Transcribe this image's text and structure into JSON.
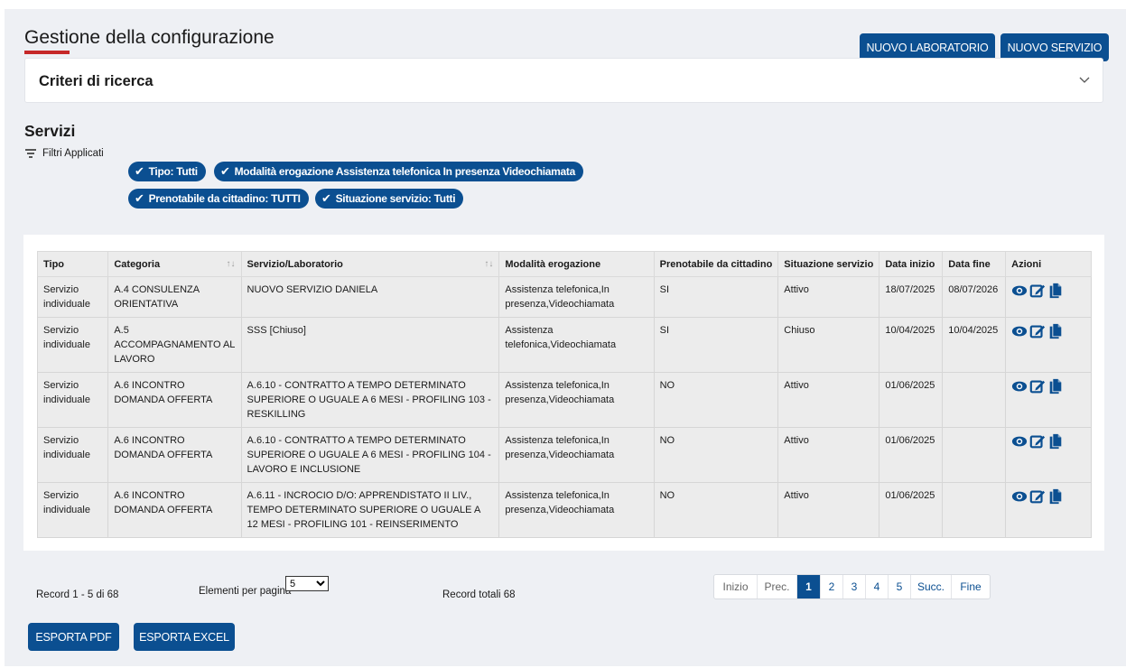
{
  "header": {
    "title": "Gestione della configurazione",
    "btn_new_lab": "NUOVO LABORATORIO",
    "btn_new_service": "NUOVO SERVIZIO"
  },
  "criteri": {
    "label": "Criteri di ricerca"
  },
  "servizi": {
    "title": "Servizi",
    "filters_label": "Filtri Applicati",
    "chips": [
      "Tipo: Tutti",
      "Modalità erogazione  Assistenza telefonica  In presenza  Videochiamata",
      "Prenotabile da cittadino: TUTTI",
      "Situazione servizio: Tutti"
    ]
  },
  "table": {
    "headers": [
      "Tipo",
      "Categoria",
      "Servizio/Laboratorio",
      "Modalità erogazione",
      "Prenotabile da cittadino",
      "Situazione servizio",
      "Data inizio",
      "Data fine",
      "Azioni"
    ],
    "rows": [
      {
        "tipo": "Servizio individuale",
        "categoria": "A.4 CONSULENZA ORIENTATIVA",
        "servizio": "NUOVO SERVIZIO DANIELA",
        "modalita": "Assistenza telefonica,In presenza,Videochiamata",
        "prenotabile": "SI",
        "situazione": "Attivo",
        "inizio": "18/07/2025",
        "fine": "08/07/2026"
      },
      {
        "tipo": "Servizio individuale",
        "categoria": "A.5 ACCOMPAGNAMENTO AL LAVORO",
        "servizio": "SSS [Chiuso]",
        "modalita": "Assistenza telefonica,Videochiamata",
        "prenotabile": "SI",
        "situazione": "Chiuso",
        "inizio": "10/04/2025",
        "fine": "10/04/2025"
      },
      {
        "tipo": "Servizio individuale",
        "categoria": "A.6 INCONTRO DOMANDA OFFERTA",
        "servizio": "A.6.10 - CONTRATTO A TEMPO DETERMINATO SUPERIORE O UGUALE A 6 MESI - PROFILING 103 - RESKILLING",
        "modalita": "Assistenza telefonica,In presenza,Videochiamata",
        "prenotabile": "NO",
        "situazione": "Attivo",
        "inizio": "01/06/2025",
        "fine": ""
      },
      {
        "tipo": "Servizio individuale",
        "categoria": "A.6 INCONTRO DOMANDA OFFERTA",
        "servizio": "A.6.10 - CONTRATTO A TEMPO DETERMINATO SUPERIORE O UGUALE A 6 MESI - PROFILING 104 - LAVORO E INCLUSIONE",
        "modalita": "Assistenza telefonica,In presenza,Videochiamata",
        "prenotabile": "NO",
        "situazione": "Attivo",
        "inizio": "01/06/2025",
        "fine": ""
      },
      {
        "tipo": "Servizio individuale",
        "categoria": "A.6 INCONTRO DOMANDA OFFERTA",
        "servizio": "A.6.11 - INCROCIO D/O: APPRENDISTATO II LIV., TEMPO DETERMINATO SUPERIORE O UGUALE A 12 MESI - PROFILING 101 - REINSERIMENTO",
        "modalita": "Assistenza telefonica,In presenza,Videochiamata",
        "prenotabile": "NO",
        "situazione": "Attivo",
        "inizio": "01/06/2025",
        "fine": ""
      }
    ]
  },
  "footer": {
    "record_range": "Record 1 - 5 di 68",
    "per_page_label": "Elementi per pagina",
    "per_page_value": "5",
    "total": "Record totali 68",
    "pager": [
      "Inizio",
      "Prec.",
      "1",
      "2",
      "3",
      "4",
      "5",
      "Succ.",
      "Fine"
    ],
    "btn_pdf": "ESPORTA PDF",
    "btn_excel": "ESPORTA EXCEL"
  },
  "colors": {
    "primary": "#0b4f91",
    "accent_red": "#c62828",
    "background": "#eef0f4"
  },
  "icons": [
    "chevron-down-icon",
    "filter-icon",
    "check-icon",
    "eye-icon",
    "edit-icon",
    "copy-icon",
    "sort-icon"
  ]
}
